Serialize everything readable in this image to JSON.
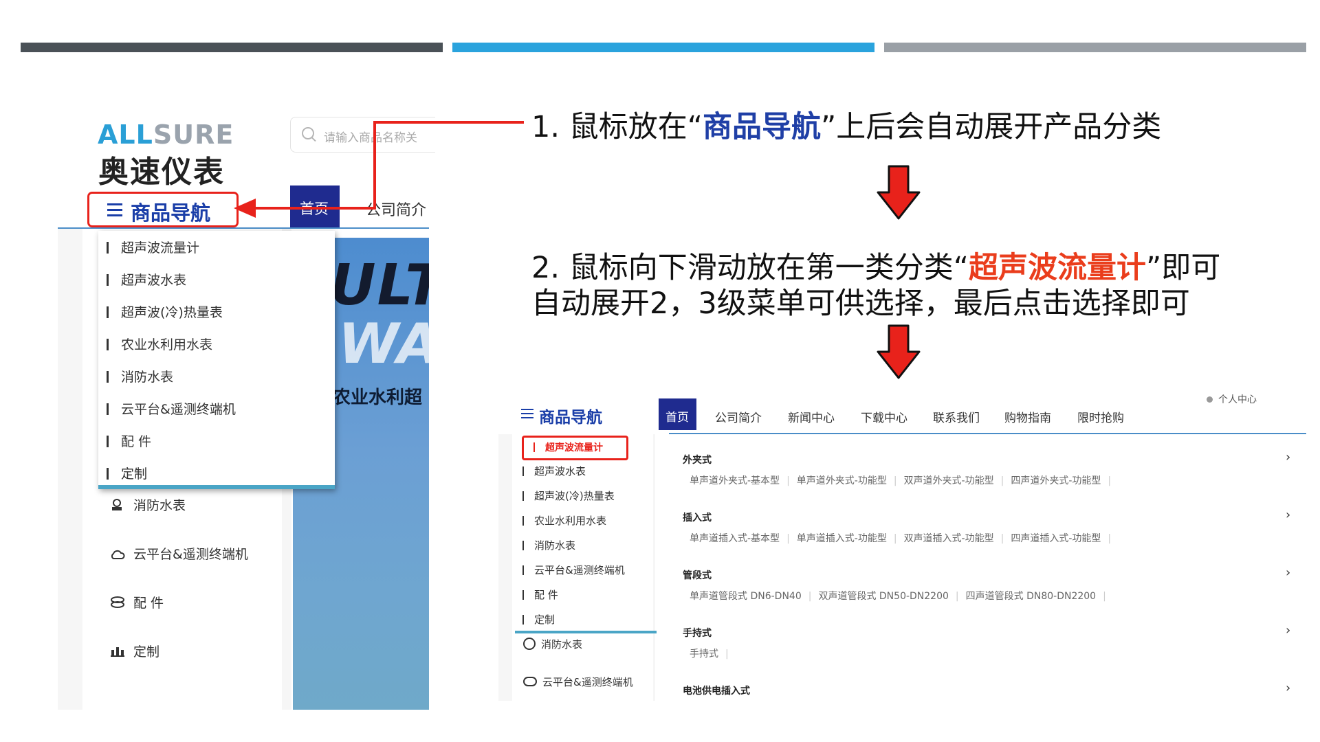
{
  "header_bars": [
    {
      "color": "#4a5157"
    },
    {
      "color": "#2aa3dd"
    },
    {
      "color": "#9aa0a6"
    }
  ],
  "colors": {
    "highlight_red": "#e8221b",
    "nav_blue": "#1a3ea8",
    "accent_teal": "#4aa5c6"
  },
  "left_shot": {
    "logo_text_left": "ALL",
    "logo_text_right": "SURE",
    "logo_cn": "奥速仪表",
    "search_placeholder": "请输入商品名称关",
    "nav_button": "商品导航",
    "tab_home": "首页",
    "tab_about": "公司简介",
    "dropdown": [
      "超声波流量计",
      "超声波水表",
      "超声波(冷)热量表",
      "农业水利用水表",
      "消防水表",
      "云平台&遥测终端机",
      "配 件",
      "定制"
    ],
    "behind_items": [
      {
        "label": "消防水表",
        "icon": "fire-meter-icon"
      },
      {
        "label": "云平台&遥测终端机",
        "icon": "cloud-icon"
      },
      {
        "label": "配 件",
        "icon": "parts-icon"
      },
      {
        "label": "定制",
        "icon": "custom-icon"
      }
    ],
    "banner_text_1": "ULTR",
    "banner_text_2": "WAT",
    "banner_text_3": "农业水利超"
  },
  "steps": {
    "step1_prefix": "1. 鼠标放在“",
    "step1_keyword": "商品导航",
    "step1_suffix": "”上后会自动展开产品分类",
    "step2_line1_prefix": "2. 鼠标向下滑动放在第一类分类“",
    "step2_keyword": "超声波流量计",
    "step2_line1_suffix": "”即可",
    "step2_line2": "自动展开2，3级菜单可供选择，最后点击选择即可"
  },
  "right_shot": {
    "nav_button": "商品导航",
    "tabs": [
      "首页",
      "公司简介",
      "新闻中心",
      "下载中心",
      "联系我们",
      "购物指南",
      "限时抢购"
    ],
    "user_center": "个人中心",
    "side_items": [
      "超声波流量计",
      "超声波水表",
      "超声波(冷)热量表",
      "农业水利用水表",
      "消防水表",
      "云平台&遥测终端机",
      "配 件",
      "定制"
    ],
    "behind_items": [
      "消防水表",
      "云平台&遥测终端机"
    ],
    "categories": [
      {
        "title": "外夹式",
        "subs": [
          "单声道外夹式-基本型",
          "单声道外夹式-功能型",
          "双声道外夹式-功能型",
          "四声道外夹式-功能型"
        ]
      },
      {
        "title": "插入式",
        "subs": [
          "单声道插入式-基本型",
          "单声道插入式-功能型",
          "双声道插入式-功能型",
          "四声道插入式-功能型"
        ]
      },
      {
        "title": "管段式",
        "subs": [
          "单声道管段式 DN6-DN40",
          "双声道管段式 DN50-DN2200",
          "四声道管段式 DN80-DN2200"
        ]
      },
      {
        "title": "手持式",
        "subs": [
          "手持式"
        ]
      },
      {
        "title": "电池供电插入式",
        "subs": []
      }
    ]
  }
}
